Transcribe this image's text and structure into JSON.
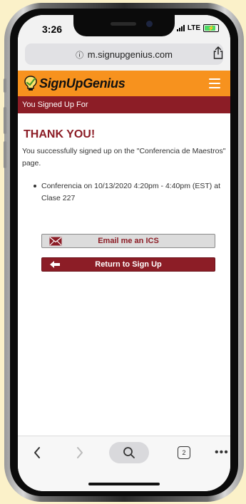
{
  "status_bar": {
    "time": "3:26",
    "network": "LTE",
    "battery_charging": true
  },
  "browser": {
    "url": "m.signupgenius.com",
    "open_tabs": "2"
  },
  "site": {
    "logo_text": "SignUpGenius",
    "subheader": "You Signed Up For"
  },
  "page": {
    "heading": "THANK YOU!",
    "message": "You successfully signed up on the \"Conferencia de Maestros\" page.",
    "signups": [
      "Conferencia on 10/13/2020 4:20pm - 4:40pm (EST) at Clase 227"
    ]
  },
  "buttons": {
    "email_ics": "Email me an ICS",
    "return": "Return to Sign Up"
  },
  "colors": {
    "brand_orange": "#f7921e",
    "brand_maroon": "#8c1d26",
    "page_background": "#fbf1c9"
  },
  "icons": {
    "secure": "info-circle-icon",
    "share": "share-icon",
    "menu": "hamburger-menu-icon",
    "email": "envelope-icon",
    "return": "arrow-left-icon",
    "back": "chevron-left-icon",
    "forward": "chevron-right-icon",
    "search": "search-icon",
    "tabs": "tabs-icon",
    "more": "more-dots-icon"
  }
}
